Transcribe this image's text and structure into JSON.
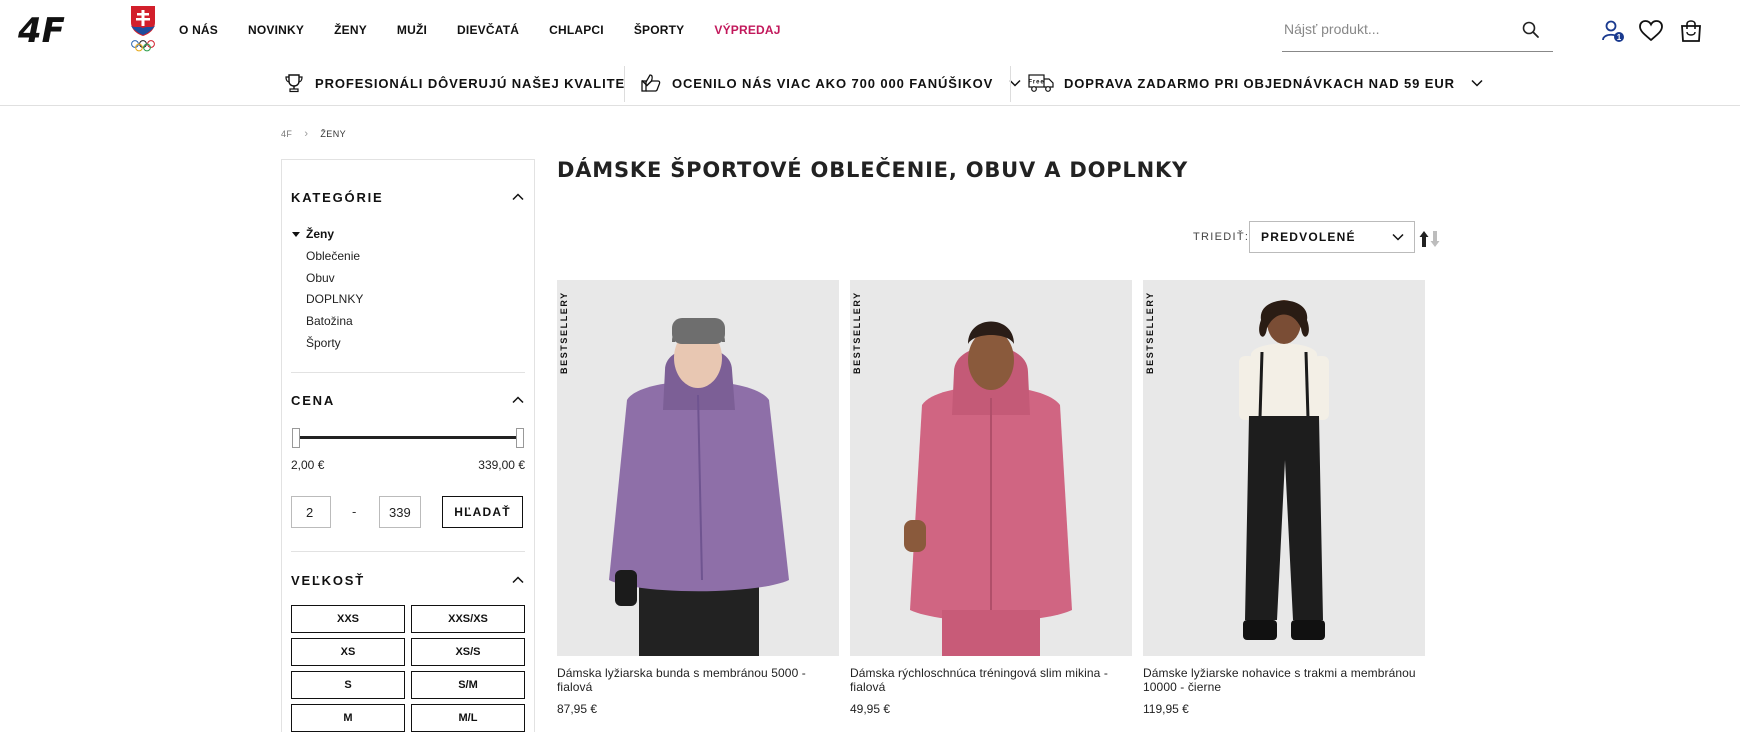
{
  "brand": {
    "logo_text": "4F"
  },
  "nav": {
    "items": [
      "O NÁS",
      "NOVINKY",
      "ŽENY",
      "MUŽI",
      "DIEVČATÁ",
      "CHLAPCI",
      "ŠPORTY"
    ],
    "sale": "VÝPREDAJ",
    "sale_color": "#c2185b"
  },
  "search": {
    "placeholder": "Nájsť produkt..."
  },
  "header_icons": {
    "user": "user-icon",
    "user_badge": "1",
    "wishlist": "heart-icon",
    "cart": "shopping-bag-icon"
  },
  "benefits": [
    {
      "icon": "trophy-icon",
      "label": "PROFESIONÁLI DÔVERUJÚ NAŠEJ KVALITE"
    },
    {
      "icon": "thumbs-up-icon",
      "label": "OCENILO NÁS VIAC AKO 700 000 FANÚŠIKOV"
    },
    {
      "icon": "free-delivery-truck-icon",
      "icon_text": "Free",
      "label": "DOPRAVA ZADARMO PRI OBJEDNÁVKACH NAD 59 EUR"
    }
  ],
  "breadcrumb": {
    "root": "4F",
    "current": "ŽENY"
  },
  "filters": {
    "categories": {
      "title": "KATEGÓRIE",
      "root": "Ženy",
      "items": [
        "Oblečenie",
        "Obuv",
        "DOPLNKY",
        "Batožina",
        "Športy"
      ]
    },
    "price": {
      "title": "CENA",
      "min_label": "2,00 €",
      "max_label": "339,00 €",
      "min_value": "2",
      "max_value": "339",
      "dash": "-",
      "button": "HĽADAŤ"
    },
    "size": {
      "title": "VEĽKOSŤ",
      "options": [
        "XXS",
        "XXS/XS",
        "XS",
        "XS/S",
        "S",
        "S/M",
        "M",
        "M/L"
      ]
    }
  },
  "main": {
    "title": "DÁMSKE ŠPORTOVÉ OBLEČENIE, OBUV A DOPLNKY",
    "sort_label": "TRIEDIŤ:",
    "sort_value": "PREDVOLENÉ"
  },
  "products": [
    {
      "badge": "BESTSELLERY",
      "name": "Dámska lyžiarska bunda s membránou 5000 - fialová",
      "price": "87,95 €",
      "color": "#8e6fa8"
    },
    {
      "badge": "BESTSELLERY",
      "name": "Dámska rýchloschnúca tréningová slim mikina - fialová",
      "price": "49,95 €",
      "color": "#d06582"
    },
    {
      "badge": "BESTSELLERY",
      "name": "Dámske lyžiarske nohavice s trakmi a membránou 10000 - čierne",
      "price": "119,95 €",
      "color": "#1d1d1d"
    }
  ]
}
